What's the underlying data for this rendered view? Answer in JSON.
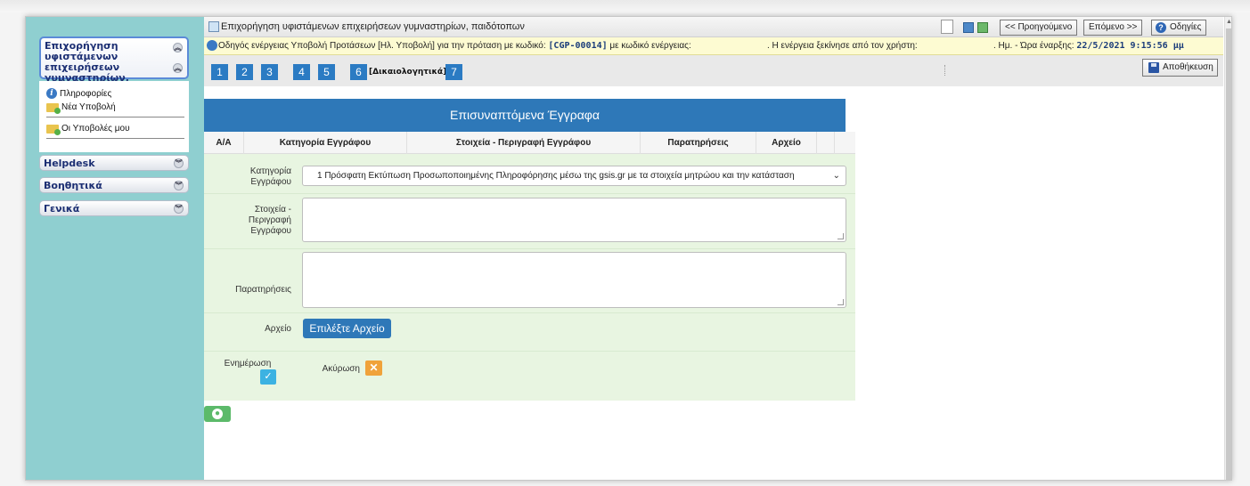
{
  "sidebar": {
    "active_menu": "Επιχορήγηση υφιστάμενων επιχειρήσεων γυμναστηρίων, παιδότοπων",
    "items": [
      {
        "label": "Πληροφορίες"
      },
      {
        "label": "Νέα Υποβολή"
      },
      {
        "label": "Οι Υποβολές μου"
      }
    ],
    "groups": [
      {
        "label": "Helpdesk"
      },
      {
        "label": "Βοηθητικά"
      },
      {
        "label": "Γενικά"
      }
    ]
  },
  "title_bar": {
    "title": "Επιχορήγηση υφιστάμενων επιχειρήσεων γυμναστηρίων, παιδότοπων",
    "prev_label": "<< Προηγούμενο",
    "next_label": "Επόμενο >>",
    "help_label": "Οδηγίες"
  },
  "info_bar": {
    "wizard_text": "Οδηγός ενέργειας Υποβολή Προτάσεων [Ηλ. Υποβολή] για την πρόταση με κωδικό:",
    "proposal_code": "[CGP-00014]",
    "action_code_label": "με κωδικό ενέργειας:",
    "user_text": ". Η ενέργεια ξεκίνησε από τον χρήστη:",
    "start_label": ". Ημ. - Ώρα έναρξης:",
    "start_value": "22/5/2021 9:15:56 μμ"
  },
  "steps": [
    "1",
    "2",
    "3",
    "4",
    "5",
    "6",
    "7"
  ],
  "current_step_label": "[Δικαιολογητικά]",
  "save_label": "Αποθήκευση",
  "form": {
    "heading": "Επισυναπτόμενα Έγγραφα",
    "columns": [
      "Α/Α",
      "Κατηγορία Εγγράφου",
      "Στοιχεία - Περιγραφή Εγγράφου",
      "Παρατηρήσεις",
      "Αρχείο"
    ],
    "category_label": "Κατηγορία Εγγράφου",
    "category_value": "1 Πρόσφατη Εκτύπωση Προσωποποιημένης Πληροφόρησης μέσω της gsis.gr με τα στοιχεία μητρώου και την κατάσταση",
    "description_label": "Στοιχεία - Περιγραφή Εγγράφου",
    "description_value": "",
    "notes_label": "Παρατηρήσεις",
    "notes_value": "",
    "file_label": "Αρχείο",
    "file_button": "Επιλέξτε Αρχείο",
    "update_label": "Ενημέρωση",
    "cancel_label": "Ακύρωση"
  }
}
